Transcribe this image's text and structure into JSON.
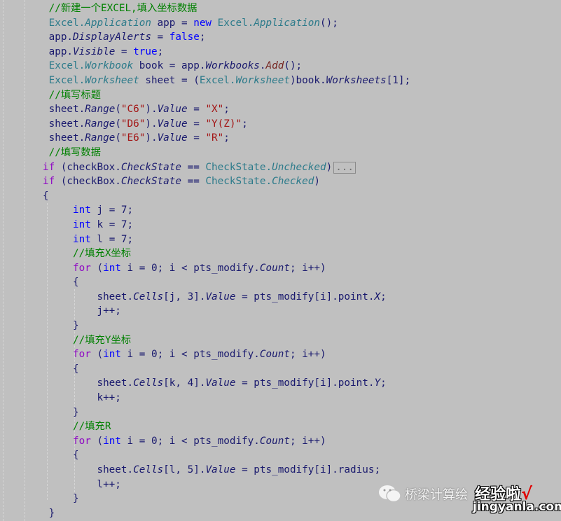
{
  "editor": {
    "lines": [
      [
        [
          " //新建一个EXCEL,填入坐标数据",
          "c"
        ]
      ],
      [
        [
          " Excel.",
          "t"
        ],
        [
          "Application",
          "ti"
        ],
        [
          " app = ",
          "p"
        ],
        [
          "new",
          "k"
        ],
        [
          " Excel.",
          "t"
        ],
        [
          "Application",
          "ti"
        ],
        [
          "();",
          "p"
        ]
      ],
      [
        [
          " app.",
          "p"
        ],
        [
          "DisplayAlerts",
          "i"
        ],
        [
          " = ",
          "p"
        ],
        [
          "false",
          "k"
        ],
        [
          ";",
          "p"
        ]
      ],
      [
        [
          " app.",
          "p"
        ],
        [
          "Visible",
          "i"
        ],
        [
          " = ",
          "p"
        ],
        [
          "true",
          "k"
        ],
        [
          ";",
          "p"
        ]
      ],
      [
        [
          " Excel.",
          "t"
        ],
        [
          "Workbook",
          "ti"
        ],
        [
          " book = app.",
          "p"
        ],
        [
          "Workbooks",
          "i"
        ],
        [
          ".",
          "p"
        ],
        [
          "Add",
          "m"
        ],
        [
          "();",
          "p"
        ]
      ],
      [
        [
          " Excel.",
          "t"
        ],
        [
          "Worksheet",
          "ti"
        ],
        [
          " sheet = (",
          "p"
        ],
        [
          "Excel.",
          "t"
        ],
        [
          "Worksheet",
          "ti"
        ],
        [
          ")book.",
          "p"
        ],
        [
          "Worksheets",
          "i"
        ],
        [
          "[1];",
          "p"
        ]
      ],
      [
        [
          " //填写标题",
          "c"
        ]
      ],
      [
        [
          " sheet.",
          "p"
        ],
        [
          "Range",
          "i"
        ],
        [
          "(",
          "p"
        ],
        [
          "\"C6\"",
          "s"
        ],
        [
          ").",
          "p"
        ],
        [
          "Value",
          "i"
        ],
        [
          " = ",
          "p"
        ],
        [
          "\"X\"",
          "s"
        ],
        [
          ";",
          "p"
        ]
      ],
      [
        [
          " sheet.",
          "p"
        ],
        [
          "Range",
          "i"
        ],
        [
          "(",
          "p"
        ],
        [
          "\"D6\"",
          "s"
        ],
        [
          ").",
          "p"
        ],
        [
          "Value",
          "i"
        ],
        [
          " = ",
          "p"
        ],
        [
          "\"Y(Z)\"",
          "s"
        ],
        [
          ";",
          "p"
        ]
      ],
      [
        [
          " sheet.",
          "p"
        ],
        [
          "Range",
          "i"
        ],
        [
          "(",
          "p"
        ],
        [
          "\"E6\"",
          "s"
        ],
        [
          ").",
          "p"
        ],
        [
          "Value",
          "i"
        ],
        [
          " = ",
          "p"
        ],
        [
          "\"R\"",
          "s"
        ],
        [
          ";",
          "p"
        ]
      ],
      [
        [
          " //填写数据",
          "c"
        ]
      ],
      [
        [
          "if",
          "ctl"
        ],
        [
          " (checkBox.",
          "p"
        ],
        [
          "CheckState",
          "i"
        ],
        [
          " == ",
          "p"
        ],
        [
          "CheckState.",
          "t"
        ],
        [
          "Unchecked",
          "ti"
        ],
        [
          ")",
          "p"
        ],
        [
          "...",
          "fold"
        ]
      ],
      [
        [
          "if",
          "ctl"
        ],
        [
          " (checkBox.",
          "p"
        ],
        [
          "CheckState",
          "i"
        ],
        [
          " == ",
          "p"
        ],
        [
          "CheckState.",
          "t"
        ],
        [
          "Checked",
          "ti"
        ],
        [
          ")",
          "p"
        ]
      ],
      [
        [
          "{",
          "p"
        ]
      ],
      [
        [
          "     ",
          "p"
        ],
        [
          "int",
          "k"
        ],
        [
          " j = 7;",
          "p"
        ]
      ],
      [
        [
          "     ",
          "p"
        ],
        [
          "int",
          "k"
        ],
        [
          " k = 7;",
          "p"
        ]
      ],
      [
        [
          "     ",
          "p"
        ],
        [
          "int",
          "k"
        ],
        [
          " l = 7;",
          "p"
        ]
      ],
      [
        [
          "     //填充X坐标",
          "c"
        ]
      ],
      [
        [
          "     ",
          "p"
        ],
        [
          "for",
          "ctl"
        ],
        [
          " (",
          "p"
        ],
        [
          "int",
          "k"
        ],
        [
          " i = 0; i < pts_modify.",
          "p"
        ],
        [
          "Count",
          "i"
        ],
        [
          "; i++)",
          "p"
        ]
      ],
      [
        [
          "     {",
          "p"
        ]
      ],
      [
        [
          "         sheet.",
          "p"
        ],
        [
          "Cells",
          "i"
        ],
        [
          "[j, 3].",
          "p"
        ],
        [
          "Value",
          "i"
        ],
        [
          " = pts_modify[i].point.",
          "p"
        ],
        [
          "X",
          "i"
        ],
        [
          ";",
          "p"
        ]
      ],
      [
        [
          "         j++;",
          "p"
        ]
      ],
      [
        [
          "     }",
          "p"
        ]
      ],
      [
        [
          "     //填充Y坐标",
          "c"
        ]
      ],
      [
        [
          "     ",
          "p"
        ],
        [
          "for",
          "ctl"
        ],
        [
          " (",
          "p"
        ],
        [
          "int",
          "k"
        ],
        [
          " i = 0; i < pts_modify.",
          "p"
        ],
        [
          "Count",
          "i"
        ],
        [
          "; i++)",
          "p"
        ]
      ],
      [
        [
          "     {",
          "p"
        ]
      ],
      [
        [
          "         sheet.",
          "p"
        ],
        [
          "Cells",
          "i"
        ],
        [
          "[k, 4].",
          "p"
        ],
        [
          "Value",
          "i"
        ],
        [
          " = pts_modify[i].point.",
          "p"
        ],
        [
          "Y",
          "i"
        ],
        [
          ";",
          "p"
        ]
      ],
      [
        [
          "         k++;",
          "p"
        ]
      ],
      [
        [
          "     }",
          "p"
        ]
      ],
      [
        [
          "     //填充R",
          "c"
        ]
      ],
      [
        [
          "     ",
          "p"
        ],
        [
          "for",
          "ctl"
        ],
        [
          " (",
          "p"
        ],
        [
          "int",
          "k"
        ],
        [
          " i = 0; i < pts_modify.",
          "p"
        ],
        [
          "Count",
          "i"
        ],
        [
          "; i++)",
          "p"
        ]
      ],
      [
        [
          "     {",
          "p"
        ]
      ],
      [
        [
          "         sheet.",
          "p"
        ],
        [
          "Cells",
          "i"
        ],
        [
          "[l, 5].",
          "p"
        ],
        [
          "Value",
          "i"
        ],
        [
          " = pts_modify[i].radius;",
          "p"
        ]
      ],
      [
        [
          "         l++;",
          "p"
        ]
      ],
      [
        [
          "     }",
          "p"
        ]
      ],
      [
        [
          " }",
          "p"
        ]
      ]
    ]
  },
  "watermark": {
    "account": "桥梁计算绘",
    "brand": "经验啦",
    "check": "√",
    "site": "jingyanla.com",
    "icon": "wechat-icon"
  }
}
